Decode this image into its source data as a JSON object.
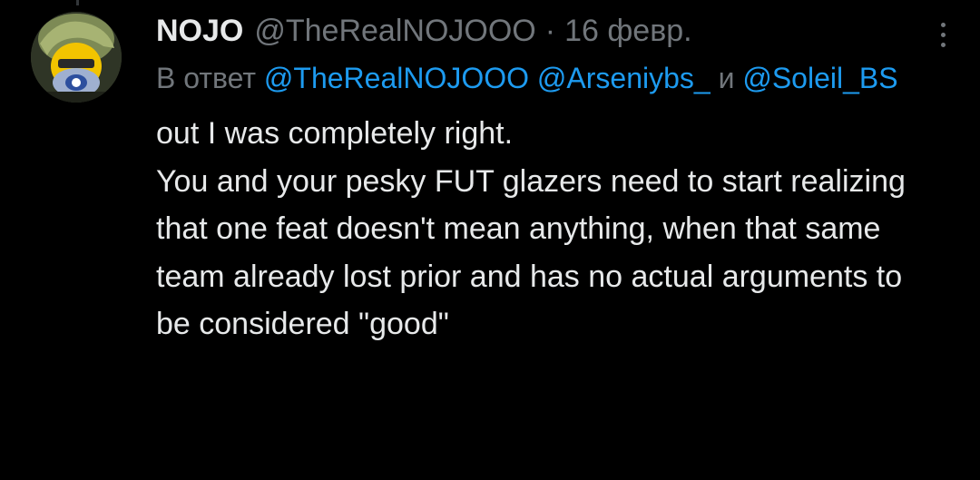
{
  "tweet": {
    "display_name": "NOJO",
    "handle": "@TheRealNOJOOO",
    "separator": "·",
    "date": "16 февр.",
    "reply_prefix": "В ответ",
    "mentions": [
      "@TheRealNOJOOO",
      "@Arseniybs_",
      "@Soleil_BS"
    ],
    "reply_conjunction": "и",
    "text": "out I was completely right.\nYou and your pesky FUT glazers need to start realizing that one feat doesn't mean anything, when that same team already lost prior and has no actual arguments to be considered \"good\""
  },
  "icons": {
    "more": "more-vertical-icon",
    "avatar": "avatar-image"
  },
  "colors": {
    "background": "#000000",
    "text_primary": "#e7e9ea",
    "text_secondary": "#71767b",
    "mention": "#1d9bf0"
  }
}
